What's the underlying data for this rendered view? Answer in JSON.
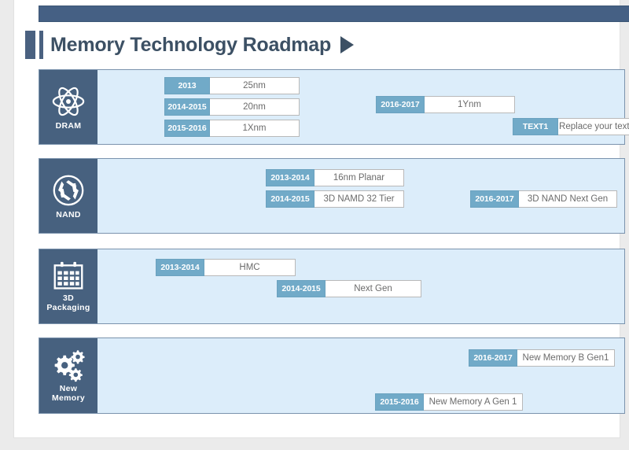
{
  "header": {
    "title": "Memory Technology Roadmap",
    "play_icon": "play-triangle-icon"
  },
  "colors": {
    "topbar": "#456084",
    "icon_panel": "#47617f",
    "row_bg": "#dcedfa",
    "chip": "#71aac8",
    "title_text": "#3c5064",
    "bar_body": "#ffffff"
  },
  "rows": [
    {
      "id": "dram",
      "label": "DRAM",
      "icon": "atom-icon",
      "bars": [
        {
          "period": "2013",
          "text": "25nm"
        },
        {
          "period": "2014-2015",
          "text": "20nm"
        },
        {
          "period": "2015-2016",
          "text": "1Xnm"
        },
        {
          "period": "2016-2017",
          "text": "1Ynm"
        },
        {
          "period": "TEXT1",
          "text": "Replace your text here."
        }
      ]
    },
    {
      "id": "nand",
      "label": "NAND",
      "icon": "aperture-icon",
      "bars": [
        {
          "period": "2013-2014",
          "text": "16nm Planar"
        },
        {
          "period": "2014-2015",
          "text": "3D NAMD 32 Tier"
        },
        {
          "period": "2016-2017",
          "text": "3D NAND Next Gen"
        }
      ]
    },
    {
      "id": "packaging",
      "label_line1": "3D",
      "label_line2": "Packaging",
      "icon": "calendar-icon",
      "bars": [
        {
          "period": "2013-2014",
          "text": "HMC"
        },
        {
          "period": "2014-2015",
          "text": "Next Gen"
        }
      ]
    },
    {
      "id": "new-memory",
      "label_line1": "New",
      "label_line2": "Memory",
      "icon": "gears-icon",
      "bars": [
        {
          "period": "2016-2017",
          "text": "New Memory B Gen1"
        },
        {
          "period": "2015-2016",
          "text": "New Memory A Gen 1"
        }
      ]
    }
  ]
}
